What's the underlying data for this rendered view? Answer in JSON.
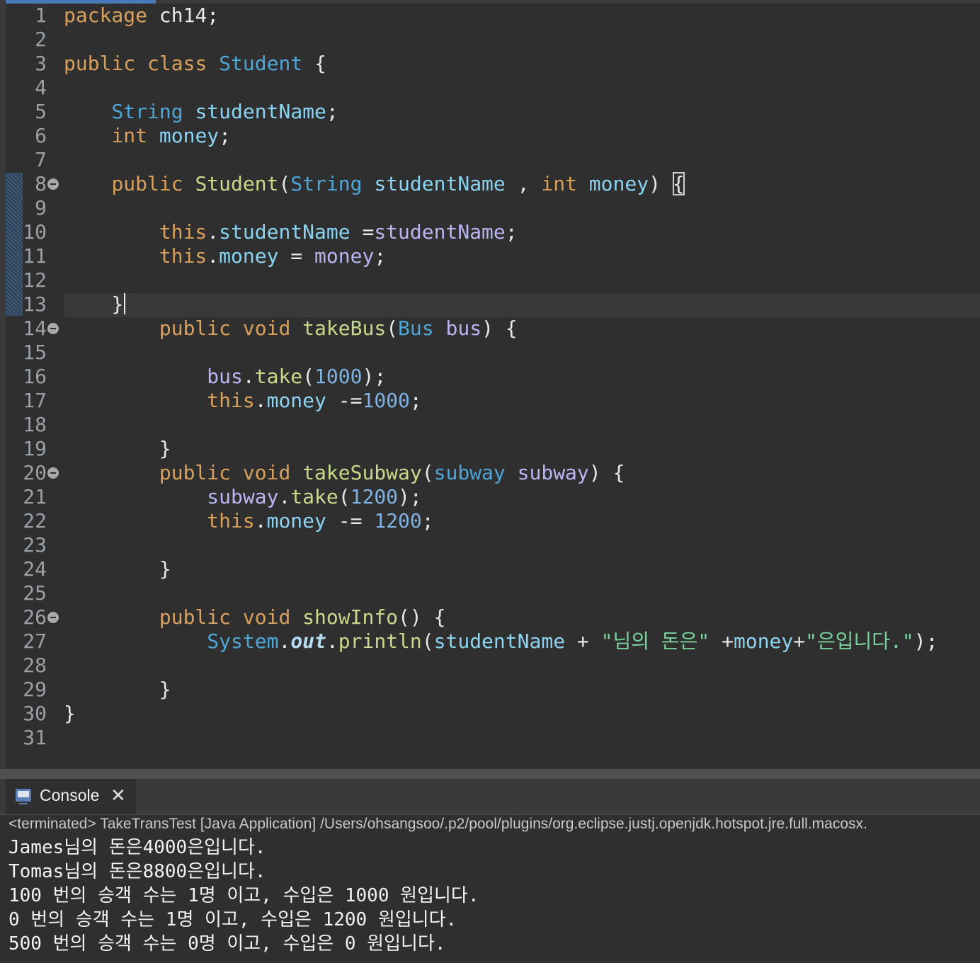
{
  "editor": {
    "lines": [
      {
        "n": "1",
        "fold": false
      },
      {
        "n": "2",
        "fold": false
      },
      {
        "n": "3",
        "fold": false
      },
      {
        "n": "4",
        "fold": false
      },
      {
        "n": "5",
        "fold": false
      },
      {
        "n": "6",
        "fold": false
      },
      {
        "n": "7",
        "fold": false
      },
      {
        "n": "8",
        "fold": true
      },
      {
        "n": "9",
        "fold": false
      },
      {
        "n": "10",
        "fold": false
      },
      {
        "n": "11",
        "fold": false
      },
      {
        "n": "12",
        "fold": false
      },
      {
        "n": "13",
        "fold": false
      },
      {
        "n": "14",
        "fold": true
      },
      {
        "n": "15",
        "fold": false
      },
      {
        "n": "16",
        "fold": false
      },
      {
        "n": "17",
        "fold": false
      },
      {
        "n": "18",
        "fold": false
      },
      {
        "n": "19",
        "fold": false
      },
      {
        "n": "20",
        "fold": true
      },
      {
        "n": "21",
        "fold": false
      },
      {
        "n": "22",
        "fold": false
      },
      {
        "n": "23",
        "fold": false
      },
      {
        "n": "24",
        "fold": false
      },
      {
        "n": "25",
        "fold": false
      },
      {
        "n": "26",
        "fold": true
      },
      {
        "n": "27",
        "fold": false
      },
      {
        "n": "28",
        "fold": false
      },
      {
        "n": "29",
        "fold": false
      },
      {
        "n": "30",
        "fold": false
      },
      {
        "n": "31",
        "fold": false
      }
    ],
    "code": {
      "l1": [
        "package",
        " ch14;"
      ],
      "l3": [
        "public",
        " ",
        "class",
        " ",
        "Student",
        " {"
      ],
      "l5": [
        "    ",
        "String",
        " ",
        "studentName",
        ";"
      ],
      "l6": [
        "    ",
        "int",
        " ",
        "money",
        ";"
      ],
      "l8": [
        "    ",
        "public",
        " ",
        "Student",
        "(",
        "String",
        " ",
        "studentName",
        " , ",
        "int",
        " ",
        "money",
        ") ",
        "{"
      ],
      "l10": [
        "        ",
        "this",
        ".",
        "studentName",
        " =",
        "studentName",
        ";"
      ],
      "l11": [
        "        ",
        "this",
        ".",
        "money",
        " = ",
        "money",
        ";"
      ],
      "l13": [
        "    ",
        "}"
      ],
      "l14": [
        "        ",
        "public",
        " ",
        "void",
        " ",
        "takeBus",
        "(",
        "Bus",
        " ",
        "bus",
        ") {"
      ],
      "l16": [
        "            ",
        "bus",
        ".",
        "take",
        "(",
        "1000",
        ");"
      ],
      "l17": [
        "            ",
        "this",
        ".",
        "money",
        " -=",
        "1000",
        ";"
      ],
      "l19": [
        "        ",
        "}"
      ],
      "l20": [
        "        ",
        "public",
        " ",
        "void",
        " ",
        "takeSubway",
        "(",
        "subway",
        " ",
        "subway",
        ") {"
      ],
      "l21": [
        "            ",
        "subway",
        ".",
        "take",
        "(",
        "1200",
        ");"
      ],
      "l22": [
        "            ",
        "this",
        ".",
        "money",
        " -= ",
        "1200",
        ";"
      ],
      "l24": [
        "        ",
        "}"
      ],
      "l26": [
        "        ",
        "public",
        " ",
        "void",
        " ",
        "showInfo",
        "() {"
      ],
      "l27": [
        "            ",
        "System",
        ".",
        "out",
        ".",
        "println",
        "(",
        "studentName",
        " + ",
        "\"님의 돈은\"",
        " +",
        "money",
        "+",
        "\"은입니다.\"",
        ");"
      ],
      "l29": [
        "        ",
        "}"
      ],
      "l30": [
        "}"
      ]
    }
  },
  "console": {
    "tab_label": "Console",
    "close_glyph": "✕",
    "status": "<terminated> TakeTransTest [Java Application] /Users/ohsangsoo/.p2/pool/plugins/org.eclipse.justj.openjdk.hotspot.jre.full.macosx.",
    "output": [
      "James님의 돈은4000은입니다.",
      "Tomas님의 돈은8800은입니다.",
      "100 번의 승객 수는 1명 이고, 수입은 1000 원입니다.",
      "0 번의 승객 수는 1명 이고, 수입은 1200 원입니다.",
      "500 번의 승객 수는 0명 이고, 수입은 0 원입니다."
    ]
  },
  "colors": {
    "background": "#2f2f2f",
    "keyword": "#d9a05b",
    "type": "#4ea6d6",
    "method": "#c7d98a",
    "field": "#8ad4f2",
    "number": "#7fb1e3",
    "string": "#78d39d"
  }
}
